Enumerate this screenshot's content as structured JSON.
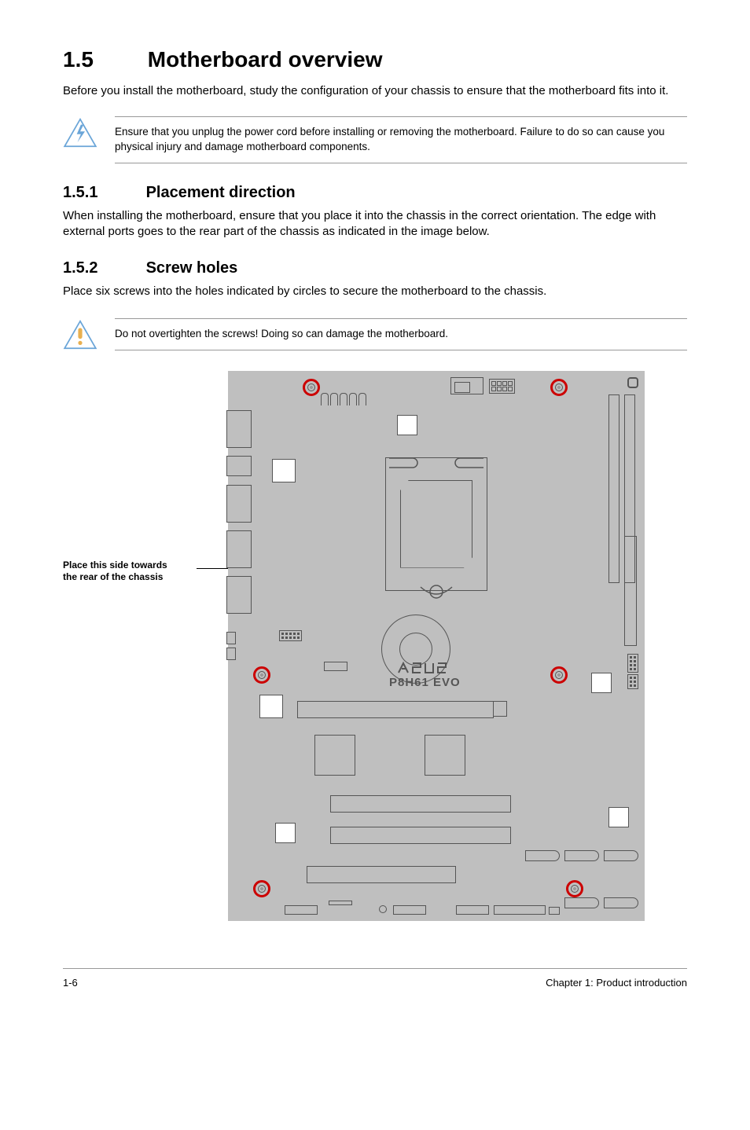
{
  "section": {
    "number": "1.5",
    "title": "Motherboard overview"
  },
  "intro": "Before you install the motherboard, study the configuration of your chassis to ensure that the motherboard fits into it.",
  "warning1": "Ensure that you unplug the power cord before installing or removing the motherboard. Failure to do so can cause you physical injury and damage motherboard components.",
  "sub1": {
    "number": "1.5.1",
    "title": "Placement direction"
  },
  "body1": "When installing the motherboard, ensure that you place it into the chassis in the correct orientation. The edge with external ports goes to the rear part of the chassis as indicated in the image below.",
  "sub2": {
    "number": "1.5.2",
    "title": "Screw holes"
  },
  "body2": "Place six screws into the holes indicated by circles to secure the motherboard to the chassis.",
  "caution": "Do not overtighten the screws! Doing so can damage the motherboard.",
  "side_label_line1": "Place this side towards",
  "side_label_line2": "the rear of the chassis",
  "board_model": "P8H61 EVO",
  "footer": {
    "page": "1-6",
    "chapter": "Chapter 1: Product introduction"
  }
}
